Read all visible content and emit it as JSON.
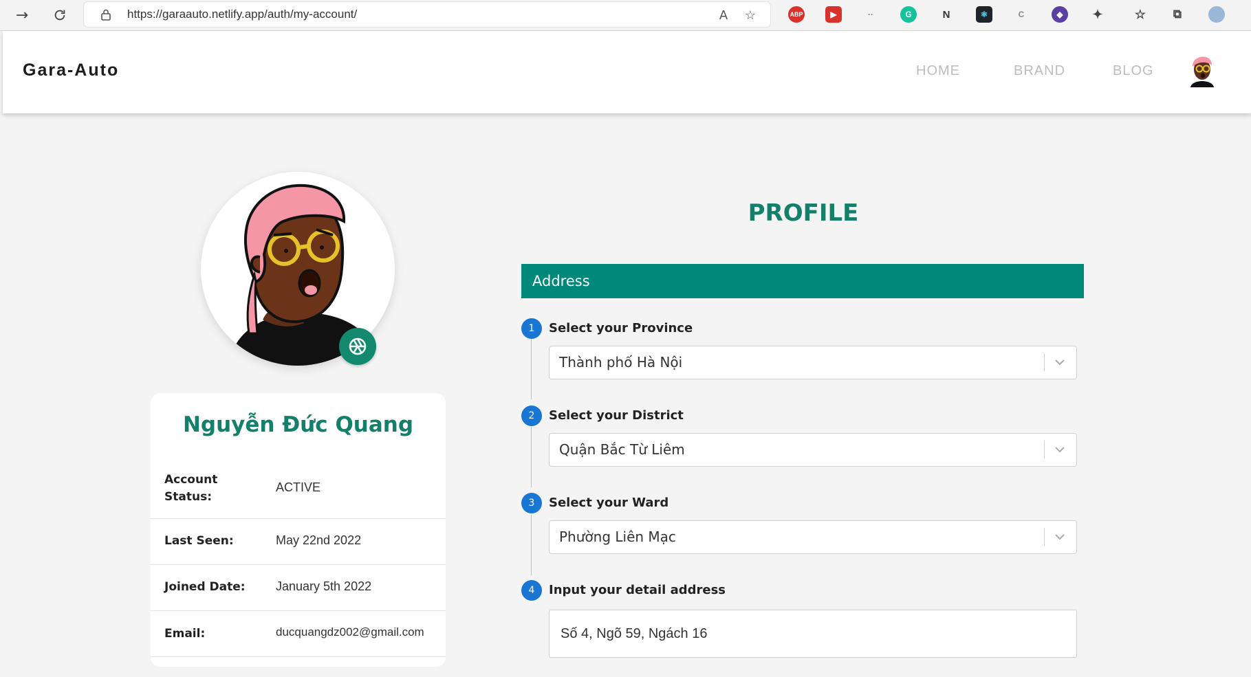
{
  "browser": {
    "url": "https://garaauto.netlify.app/auth/my-account/",
    "url_host": "https://garaauto.netlify.app",
    "url_path": "/auth/my-account/",
    "extensions": [
      "ABP",
      "N"
    ]
  },
  "header": {
    "brand": "Gara-Auto",
    "menu": [
      {
        "label": "HOME"
      },
      {
        "label": "BRAND"
      },
      {
        "label": "BLOG"
      }
    ]
  },
  "profile_card": {
    "name": "Nguyễn Đức Quang",
    "rows": [
      {
        "label": "Account Status:",
        "value": "ACTIVE"
      },
      {
        "label": "Last Seen:",
        "value": "May 22nd 2022"
      },
      {
        "label": "Joined Date:",
        "value": "January 5th 2022"
      },
      {
        "label": "Email:",
        "value": "ducquangdz002@gmail.com"
      }
    ]
  },
  "form": {
    "title": "PROFILE",
    "section": "Address",
    "steps": [
      {
        "num": "1",
        "title": "Select your Province",
        "value": "Thành phố Hà Nội"
      },
      {
        "num": "2",
        "title": "Select your District",
        "value": "Quận Bắc Từ Liêm"
      },
      {
        "num": "3",
        "title": "Select your Ward",
        "value": "Phường Liên Mạc"
      },
      {
        "num": "4",
        "title": "Input your detail address",
        "value": "Số 4, Ngõ 59, Ngách 16"
      }
    ]
  },
  "colors": {
    "accent": "#15806a",
    "section_bar": "#00897b",
    "step": "#1976d2"
  }
}
